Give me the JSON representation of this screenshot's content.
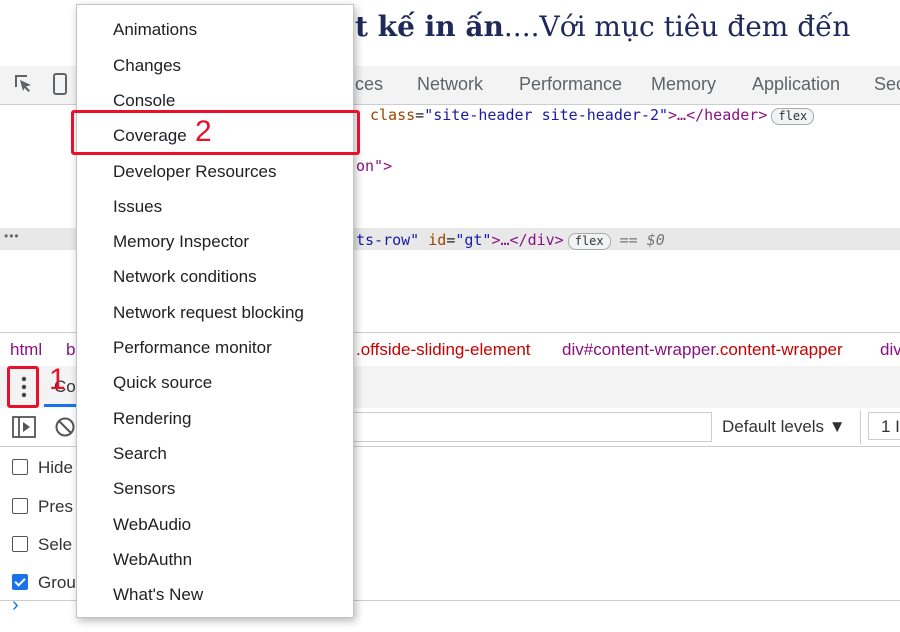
{
  "page": {
    "heading_bold": "t kế in ấn",
    "heading_rest": "....Với mục tiêu đem đến"
  },
  "devtools": {
    "tabs": [
      "ces",
      "Network",
      "Performance",
      "Memory",
      "Application",
      "Sec"
    ],
    "elements": {
      "line1_attr": "class",
      "line1_value": "\"site-header site-header-2\"",
      "line1_tail": ">…</header>",
      "line1_pill": "flex",
      "line2_frag": "on\">",
      "line3_ellipsis": "•••",
      "line3_frag1": "ts-row\"",
      "line3_attr": "id",
      "line3_value": "\"gt\"",
      "line3_tail": ">…</div>",
      "line3_pill": "flex",
      "line3_ref": "== $0"
    },
    "breadcrumb": {
      "c0": "html",
      "c1": "b",
      "c2_class": ".offside-sliding-element",
      "c3_tag": "div",
      "c3_id": "#content-wrapper",
      "c3_class": ".content-wrapper",
      "c4": "div"
    },
    "drawer": {
      "tab_fragment": "Co",
      "levels": "Default levels ▼",
      "count_fragment": "1 I",
      "options": [
        {
          "label": "Hide",
          "checked": false
        },
        {
          "label": "Pres",
          "checked": false
        },
        {
          "label": "Sele",
          "checked": false
        },
        {
          "label": "Grou",
          "checked": true
        }
      ],
      "prompt": "›"
    }
  },
  "menu": {
    "items": [
      "Animations",
      "Changes",
      "Console",
      "Coverage",
      "Developer Resources",
      "Issues",
      "Memory Inspector",
      "Network conditions",
      "Network request blocking",
      "Performance monitor",
      "Quick source",
      "Rendering",
      "Search",
      "Sensors",
      "WebAudio",
      "WebAuthn",
      "What's New"
    ]
  },
  "annotations": {
    "step1": "1",
    "step2": "2",
    "color": "#e8102a"
  }
}
